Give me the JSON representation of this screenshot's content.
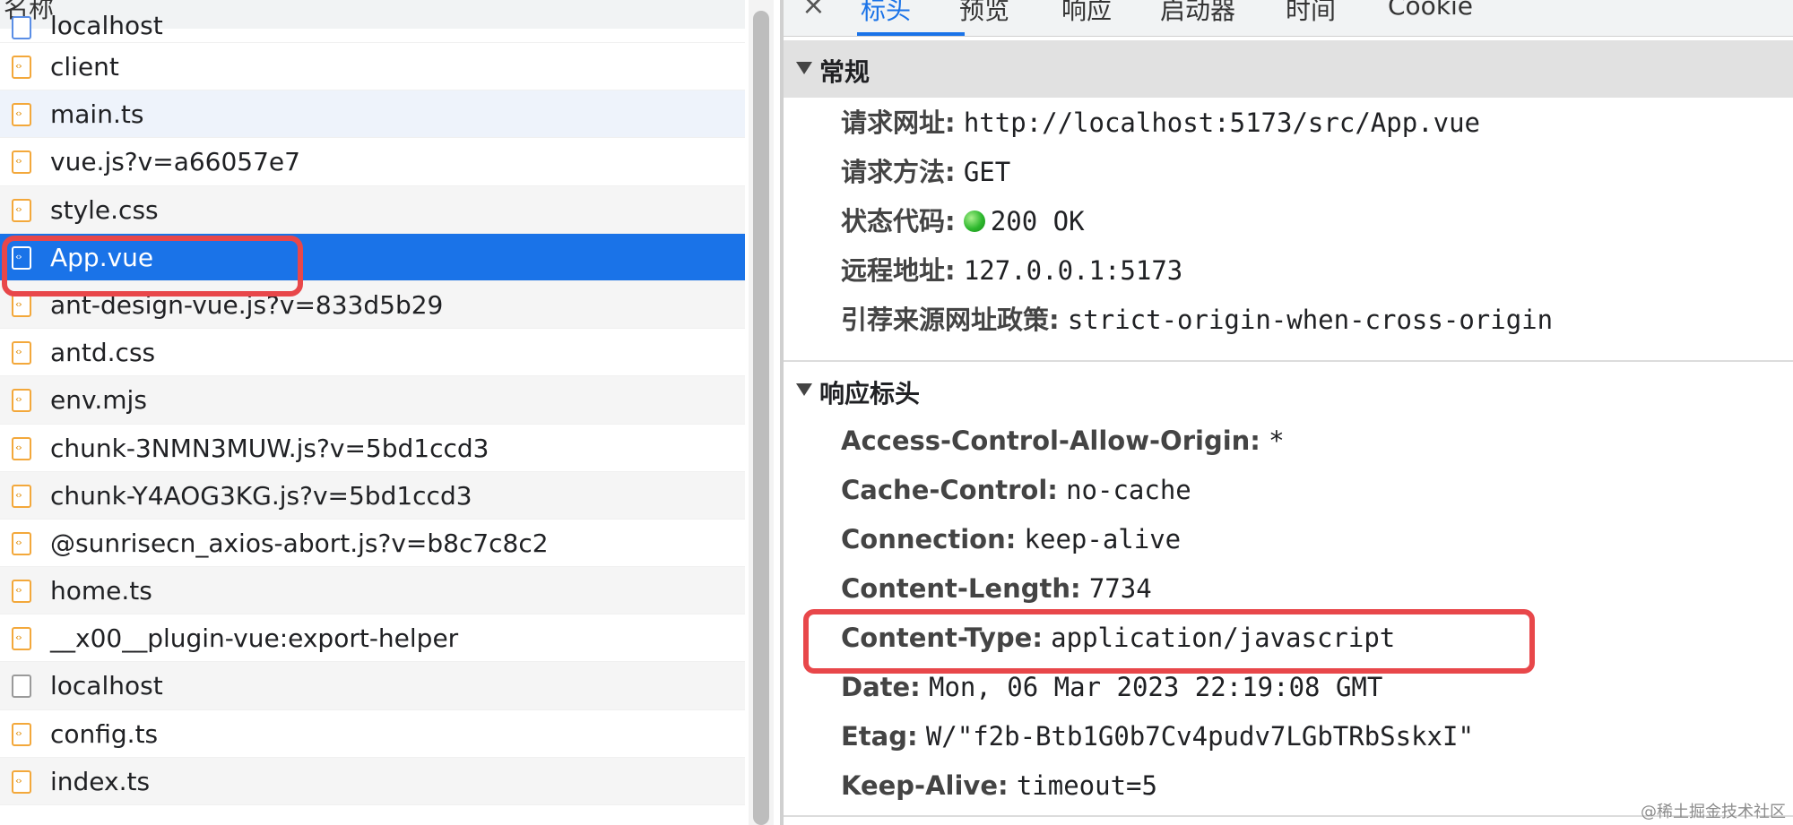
{
  "list": {
    "header": "名称",
    "partial_name": "localhost",
    "files": [
      {
        "name": "client",
        "icon": "script-file-icon"
      },
      {
        "name": "main.ts",
        "icon": "script-file-icon"
      },
      {
        "name": "vue.js?v=a66057e7",
        "icon": "script-file-icon"
      },
      {
        "name": "style.css",
        "icon": "script-file-icon"
      },
      {
        "name": "App.vue",
        "icon": "script-file-icon"
      },
      {
        "name": "ant-design-vue.js?v=833d5b29",
        "icon": "script-file-icon"
      },
      {
        "name": "antd.css",
        "icon": "script-file-icon"
      },
      {
        "name": "env.mjs",
        "icon": "script-file-icon"
      },
      {
        "name": "chunk-3NMN3MUW.js?v=5bd1ccd3",
        "icon": "script-file-icon"
      },
      {
        "name": "chunk-Y4AOG3KG.js?v=5bd1ccd3",
        "icon": "script-file-icon"
      },
      {
        "name": "@sunrisecn_axios-abort.js?v=b8c7c8c2",
        "icon": "script-file-icon"
      },
      {
        "name": "home.ts",
        "icon": "script-file-icon"
      },
      {
        "name": "__x00__plugin-vue:export-helper",
        "icon": "script-file-icon"
      },
      {
        "name": "localhost",
        "icon": "document-file-icon"
      },
      {
        "name": "config.ts",
        "icon": "script-file-icon"
      },
      {
        "name": "index.ts",
        "icon": "script-file-icon"
      }
    ]
  },
  "tabs": {
    "close": "×",
    "headers": "标头",
    "preview": "预览",
    "response": "响应",
    "initiator": "启动器",
    "timing": "时间",
    "cookie": "Cookie"
  },
  "general": {
    "title": "常规",
    "url_label": "请求网址:",
    "url": "http://localhost:5173/src/App.vue",
    "method_label": "请求方法:",
    "method": "GET",
    "status_label": "状态代码:",
    "status": "200 OK",
    "remote_label": "远程地址:",
    "remote": "127.0.0.1:5173",
    "policy_label": "引荐来源网址政策:",
    "policy": "strict-origin-when-cross-origin"
  },
  "response_headers": {
    "title": "响应标头",
    "acao_label": "Access-Control-Allow-Origin:",
    "acao": "*",
    "cache_label": "Cache-Control:",
    "cache": "no-cache",
    "conn_label": "Connection:",
    "conn": "keep-alive",
    "len_label": "Content-Length:",
    "len": "7734",
    "type_label": "Content-Type:",
    "type": "application/javascript",
    "date_label": "Date:",
    "date": "Mon, 06 Mar 2023 22:19:08 GMT",
    "etag_label": "Etag:",
    "etag": "W/\"f2b-Btb1G0b7Cv4pudv7LGbTRbSskxI\"",
    "ka_label": "Keep-Alive:",
    "ka": "timeout=5"
  },
  "watermark": "@稀土掘金技术社区",
  "colors": {
    "selected": "#1a73e8",
    "highlight_box": "#e8474a",
    "status_ok": "#2eb82e"
  }
}
